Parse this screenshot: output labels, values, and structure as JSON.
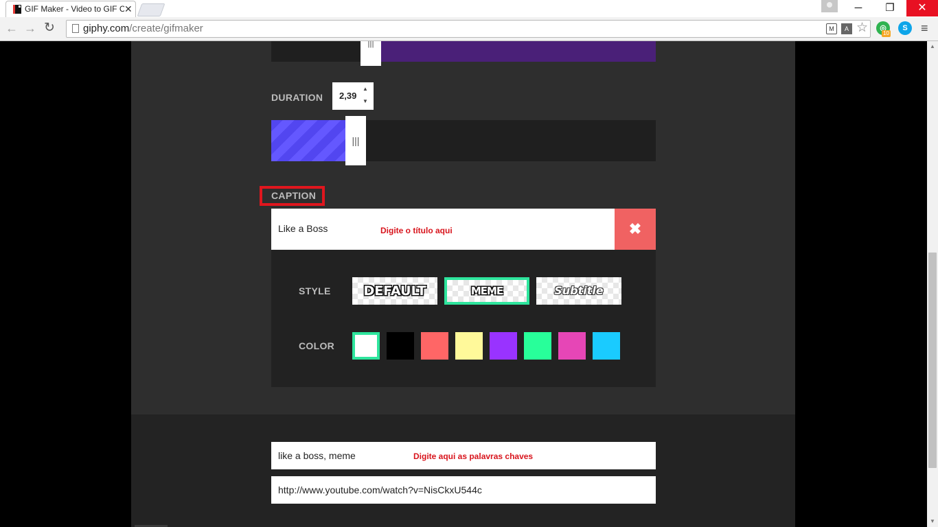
{
  "browser": {
    "tab_title": "GIF Maker - Video to GIF C",
    "tab_close": "✕",
    "url_host": "giphy.com",
    "url_path": "/create/gifmaker",
    "ext_badge": "10",
    "window_min": "─",
    "window_max": "❐",
    "window_close": "✕"
  },
  "duration": {
    "label": "DURATION",
    "value": "2,39",
    "selected_fraction": 0.193
  },
  "caption": {
    "label": "CAPTION",
    "value": "Like a Boss",
    "hint": "Digite o título aqui",
    "clear_icon": "✖",
    "style_label": "STYLE",
    "styles": [
      {
        "label": "DEFAULT",
        "selected": false
      },
      {
        "label": "MEME",
        "selected": true
      },
      {
        "label": "Subtitle",
        "selected": false
      }
    ],
    "color_label": "COLOR",
    "colors": [
      {
        "hex": "#ffffff",
        "selected": true
      },
      {
        "hex": "#000000",
        "selected": false
      },
      {
        "hex": "#ff6666",
        "selected": false
      },
      {
        "hex": "#fff99a",
        "selected": false
      },
      {
        "hex": "#9933ff",
        "selected": false
      },
      {
        "hex": "#28ff9a",
        "selected": false
      },
      {
        "hex": "#e646b6",
        "selected": false
      },
      {
        "hex": "#1acbff",
        "selected": false
      }
    ]
  },
  "tags": {
    "value": "like a boss, meme",
    "hint": "Digite aqui as palavras chaves"
  },
  "source_url": {
    "value": "http://www.youtube.com/watch?v=NisCkxU544c"
  },
  "theme": {
    "accent": "#2ee59d",
    "duration_fill": "#5246f0",
    "annotation_red": "#e0161e",
    "clear_button": "#f06262"
  }
}
